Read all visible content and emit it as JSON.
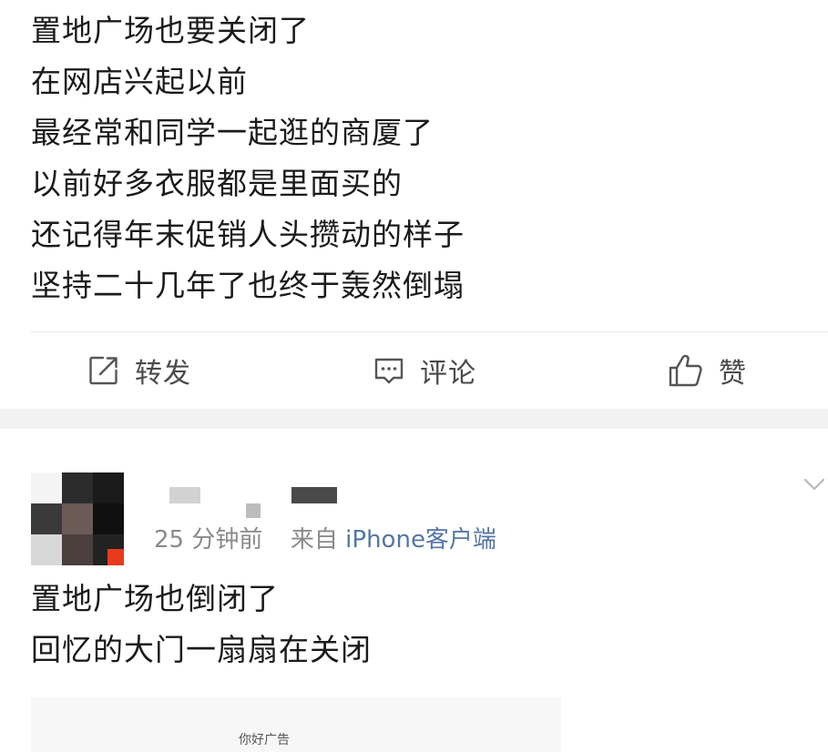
{
  "post1": {
    "lines": [
      "置地广场也要关闭了",
      "在网店兴起以前",
      "最经常和同学一起逛的商厦了",
      "以前好多衣服都是里面买的",
      "还记得年末促销人头攒动的样子",
      "坚持二十几年了也终于轰然倒塌"
    ],
    "actions": {
      "repost_label": "转发",
      "comment_label": "评论",
      "like_label": "赞"
    }
  },
  "post2": {
    "meta": {
      "time": "25 分钟前",
      "from": "来自",
      "source": "iPhone客户端"
    },
    "lines": [
      "置地广场也倒闭了",
      "回忆的大门一扇扇在关闭"
    ],
    "image_caption": "你好广告"
  },
  "icons": {
    "repost": "repost-icon",
    "comment": "comment-icon",
    "like": "thumbs-up-icon",
    "more": "chevron-down-icon"
  }
}
